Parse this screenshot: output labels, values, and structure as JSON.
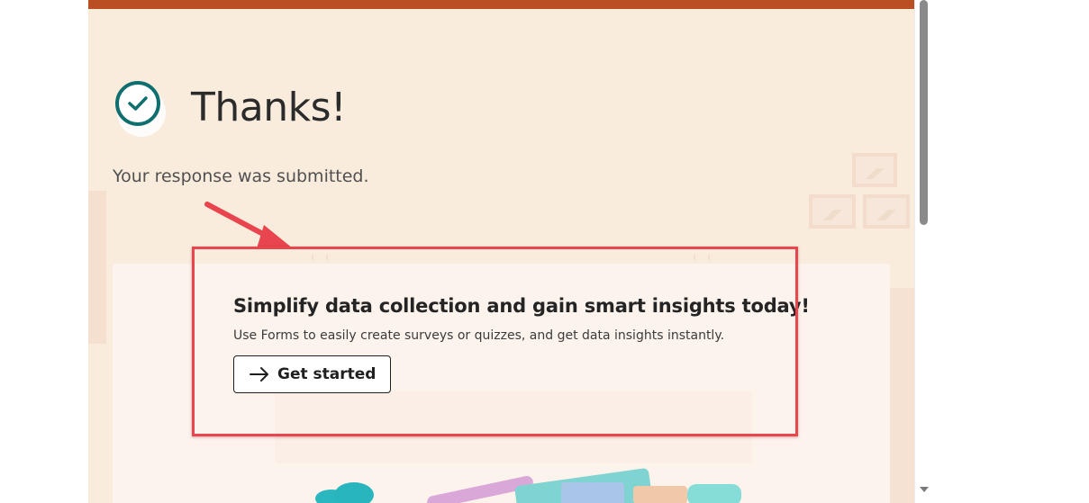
{
  "confirmation": {
    "title": "Thanks!",
    "message": "Your response was submitted.",
    "icon": "checkmark-circle-icon"
  },
  "promo": {
    "heading": "Simplify data collection and gain smart insights today!",
    "description": "Use Forms to easily create surveys or quizzes, and get data insights instantly.",
    "button_label": "Get started",
    "button_icon": "arrow-right-icon"
  },
  "theme": {
    "top_bar_color": "#b94f22",
    "page_background": "#f9ecdd",
    "check_color": "#0f6e6e",
    "annotation_color": "#e8454e"
  }
}
